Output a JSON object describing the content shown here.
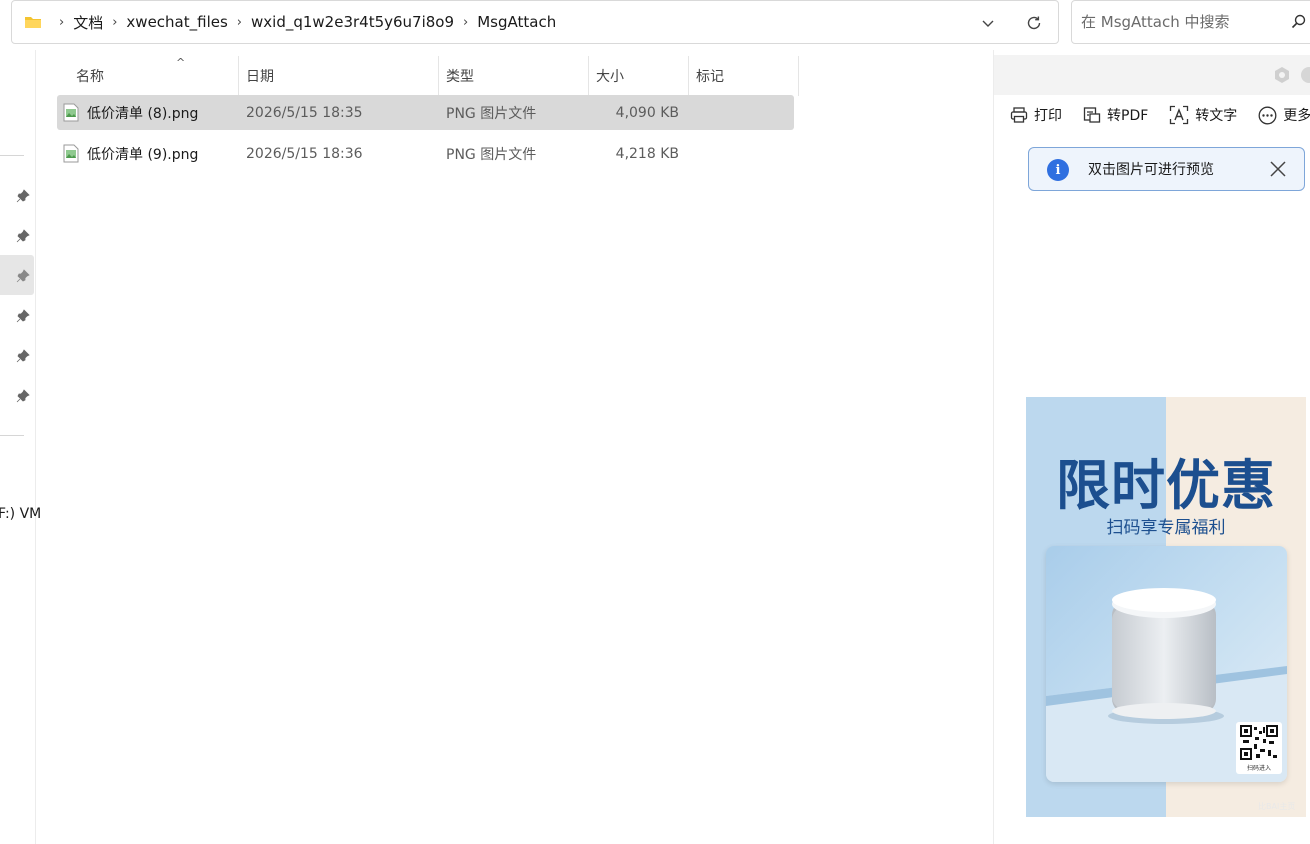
{
  "address_bar": {
    "crumbs": [
      "文档",
      "xwechat_files",
      "wxid_q1w2e3r4t5y6u7i8o9",
      "MsgAttach"
    ]
  },
  "search": {
    "placeholder": "在 MsgAttach 中搜索"
  },
  "nav": {
    "drive_label": "F:) VM"
  },
  "columns": {
    "name": "名称",
    "date": "日期",
    "type": "类型",
    "size": "大小",
    "tags": "标记"
  },
  "files": [
    {
      "name": "低价清单 (8).png",
      "date": "2026/5/15 18:35",
      "type": "PNG 图片文件",
      "size": "4,090 KB",
      "selected": true
    },
    {
      "name": "低价清单 (9).png",
      "date": "2026/5/15 18:36",
      "type": "PNG 图片文件",
      "size": "4,218 KB",
      "selected": false
    }
  ],
  "preview": {
    "toolbar": {
      "print": "打印",
      "to_pdf": "转PDF",
      "to_text": "转文字",
      "more": "更多"
    },
    "info_banner": "双击图片可进行预览",
    "poster": {
      "title": "限时优惠",
      "subtitle": "扫码享专属福利",
      "qr_label": "扫码进入",
      "watermark": "比BAI主页"
    }
  },
  "colors": {
    "accent_blue": "#2f6fe0",
    "poster_blue": "#1c4f8f",
    "selection": "#d9d9d9",
    "folder_yellow": "#f4c430"
  }
}
